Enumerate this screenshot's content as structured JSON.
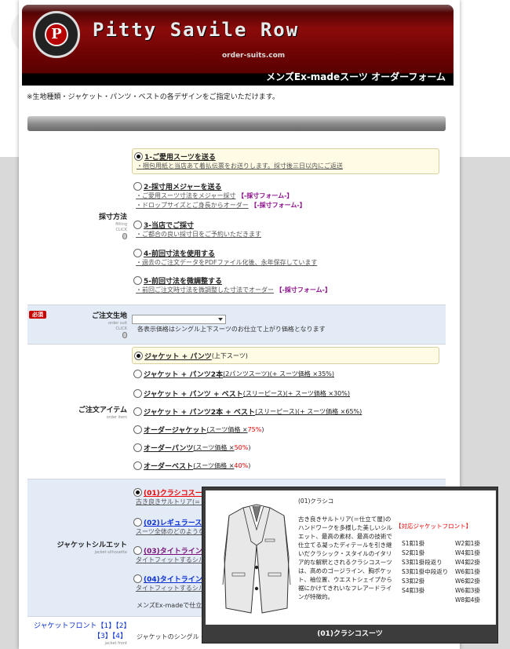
{
  "header": {
    "brand": "Pitty Savile Row",
    "domain": "order-suits.com",
    "form_title": "メンズEx-madeスーツ オーダーフォーム",
    "logo_letter": "P"
  },
  "intro_note": "※生地種類・ジャケット・パンツ・ベストの各デザインをご指定いただけます。",
  "measure": {
    "label": "採寸方法",
    "sub": "fitting",
    "click": "CLICK",
    "options": [
      {
        "title": "1-ご愛用スーツを送る",
        "desc": "・梱包用紙と当店あて着払伝票をお送りします。採寸後三日以内にご返送",
        "selected": true
      },
      {
        "title": "2-採寸用メジャーを送る",
        "desc1": "・ご愛用スーツ寸法をメジャー採寸",
        "link1": "【-採寸フォーム-】",
        "desc2": "・ドロップサイズとご身長からオーダー",
        "link2": "【-採寸フォーム-】"
      },
      {
        "title": "3-当店でご採寸",
        "desc": "・ご都合の良い採寸日をご予約いただきます"
      },
      {
        "title": "4-前回寸法を使用する",
        "desc": "・過去のご注文データをPDFファイル化後、永年保存しています"
      },
      {
        "title": "5-前回寸法を微調整する",
        "desc": "・前回ご注文時寸法を微調整した寸法でオーダー",
        "link": "【-採寸フォーム-】"
      }
    ]
  },
  "fabric": {
    "required": "必須",
    "label": "ご注文生地",
    "sub": "order suit",
    "click": "CLICK",
    "select_value": "",
    "note": "各表示価格はシングル上下スーツのお仕立て上がり価格となります"
  },
  "items": {
    "label": "ご注文アイテム",
    "sub": "order item",
    "options": [
      {
        "title": "ジャケット + パンツ",
        "suffix": "(上下スーツ)",
        "selected": true
      },
      {
        "title": "ジャケット + パンツ2本",
        "suffix": "(2パンツスーツ)(+ スーツ価格 ×35%)"
      },
      {
        "title": "ジャケット + パンツ + ベスト",
        "suffix": "(スリーピース)(+ スーツ価格 ×30%)"
      },
      {
        "title": "ジャケット + パンツ2本 + ベスト",
        "suffix": "(スリーピース)(+ スーツ価格 ×65%)"
      },
      {
        "title": "オーダージャケット",
        "suffix": "(スーツ価格 ×",
        "pct": "75%",
        "close": ")"
      },
      {
        "title": "オーダーパンツ",
        "suffix": "(スーツ価格 ×",
        "pct": "50%",
        "close": ")"
      },
      {
        "title": "オーダーベスト",
        "suffix": "(スーツ価格 ×",
        "pct": "40%",
        "close": ")"
      }
    ]
  },
  "silhouette": {
    "label": "ジャケットシルエット",
    "sub": "jacket silhouette",
    "options": [
      {
        "title": "(01)クラシコスーツ",
        "desc": "古き良きサルトリア(= 仕立",
        "selected": true
      },
      {
        "title": "(02)レギュラースーツ",
        "desc": "スーツ全体のどのような"
      },
      {
        "title": "(03)タイトライン・ナ",
        "desc": "タイトフィットするシルエット"
      },
      {
        "title": "(04)タイトライン・ク",
        "desc": "タイトフィットするシルエット"
      }
    ],
    "footer": "メンズEx-madeで仕立て"
  },
  "front": {
    "label": "ジャケットフロント【1】【2】【3】【4】",
    "sub": "jacket front",
    "desc": "ジャケットのシングル・ダブ"
  },
  "popup": {
    "title": "(01)クラシコ",
    "body": "古き良きサルトリア(＝仕立て屋)のハンドワークを多様した美しいシルエット、最高の素材、最高の技術で仕立てる凝ったディテールを引き継いだクラシック・スタイルのイタリア的な解釈とされるクラシコスーツは、高めのゴージライン、胸ポケット、袖位置、ウエストシェイプから裾にかけてきれいなフレアードラインが特徴的。",
    "front_title": "【対応ジャケットフロント】",
    "col1": [
      "S1釦1掛",
      "S2釦1掛",
      "S3釦1掛段返り",
      "S3釦1掛中段返り",
      "S3釦2掛",
      "S4釦3掛"
    ],
    "col2": [
      "W2釦1掛",
      "W4釦1掛",
      "W4釦2掛",
      "W6釦1掛",
      "W6釦2掛",
      "W6釦3掛",
      "W8釦4掛"
    ],
    "caption": "(01)クラシコスーツ"
  }
}
